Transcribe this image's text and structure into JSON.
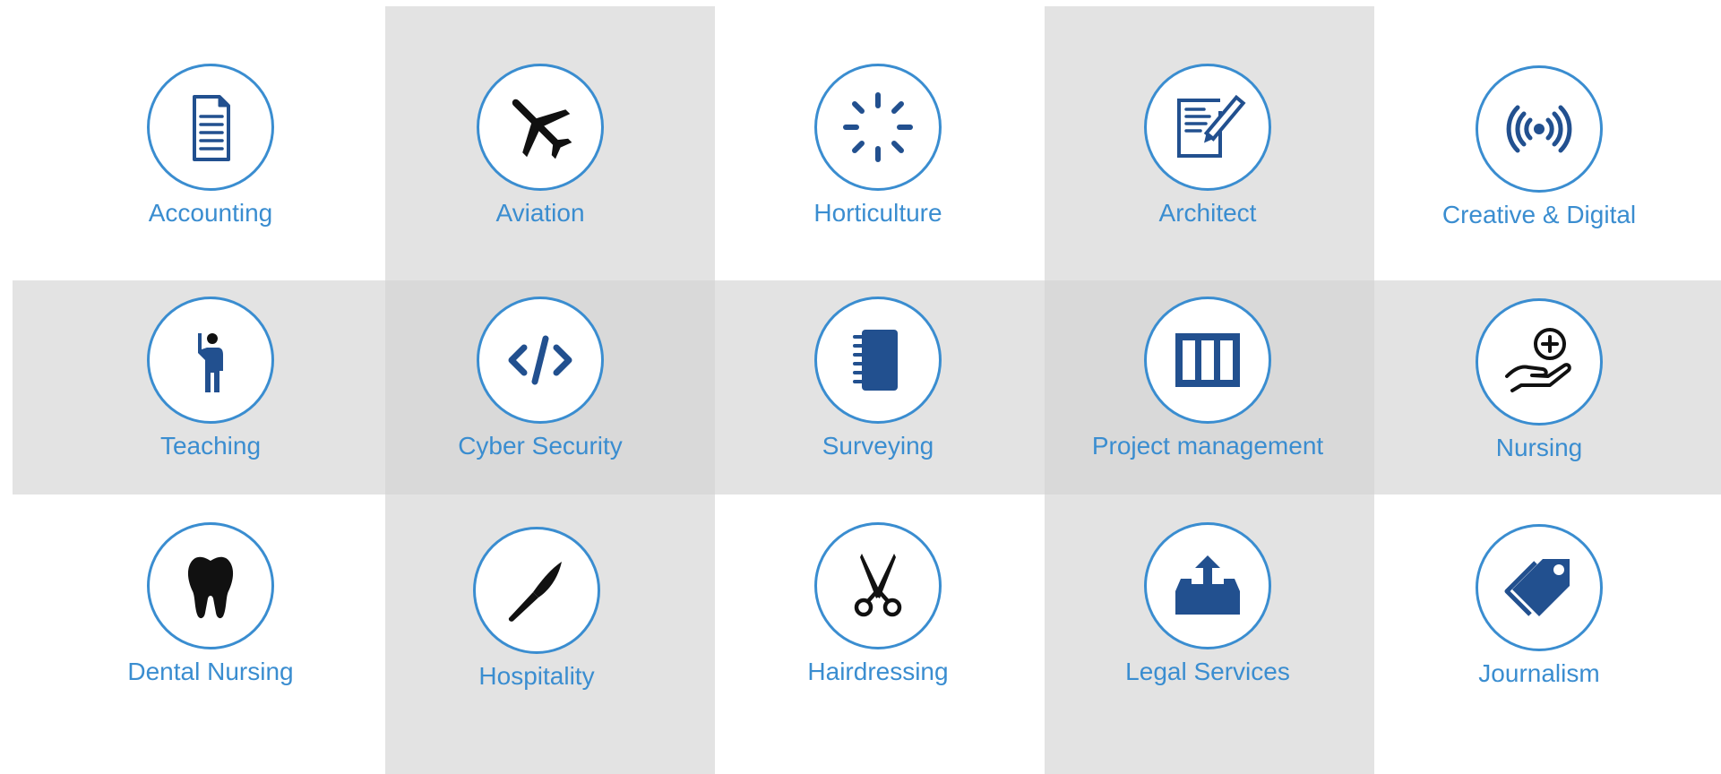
{
  "colors": {
    "accent": "#3a8dd0",
    "icon_navy": "#22508f",
    "icon_black": "#111111",
    "band_gray": "#e3e3e3"
  },
  "tiles": [
    {
      "label": "Accounting",
      "icon": "document-icon"
    },
    {
      "label": "Aviation",
      "icon": "airplane-icon"
    },
    {
      "label": "Horticulture",
      "icon": "loading-spinner-icon"
    },
    {
      "label": "Architect",
      "icon": "edit-document-icon"
    },
    {
      "label": "Creative & Digital",
      "icon": "broadcast-icon"
    },
    {
      "label": "Teaching",
      "icon": "teacher-icon"
    },
    {
      "label": "Cyber Security",
      "icon": "code-icon"
    },
    {
      "label": "Surveying",
      "icon": "notebook-icon"
    },
    {
      "label": "Project management",
      "icon": "columns-icon"
    },
    {
      "label": "Nursing",
      "icon": "care-hand-plus-icon"
    },
    {
      "label": "Dental Nursing",
      "icon": "tooth-icon"
    },
    {
      "label": "Hospitality",
      "icon": "knife-icon"
    },
    {
      "label": "Hairdressing",
      "icon": "scissors-icon"
    },
    {
      "label": "Legal Services",
      "icon": "inbox-upload-icon"
    },
    {
      "label": "Journalism",
      "icon": "tag-icon"
    }
  ]
}
